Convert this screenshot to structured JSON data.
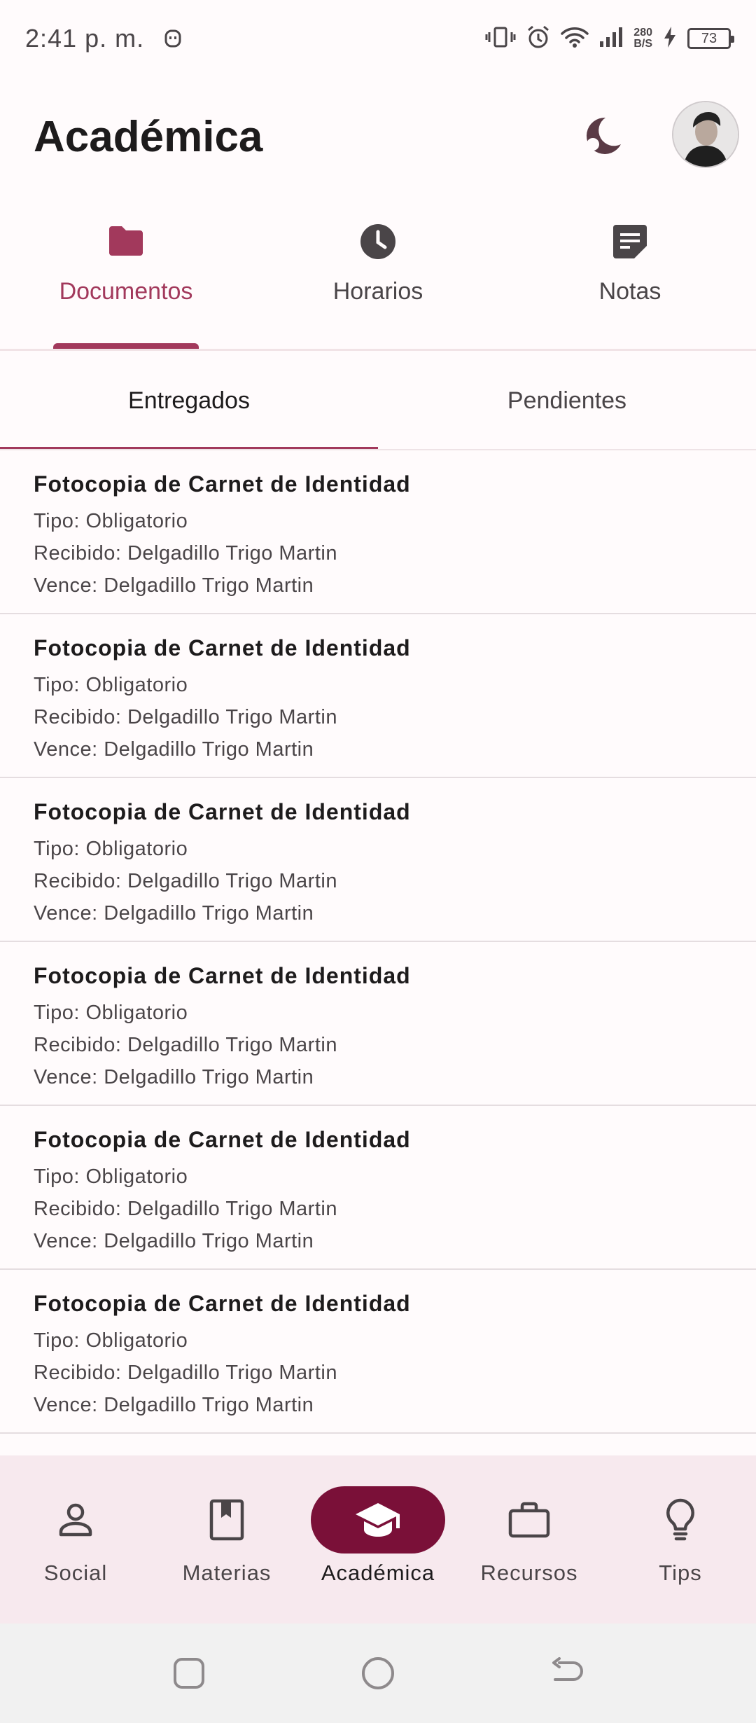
{
  "status_bar": {
    "time": "2:41 p. m.",
    "net_speed_value": "280",
    "net_speed_unit": "B/S",
    "battery": "73"
  },
  "header": {
    "title": "Académica"
  },
  "tabs": [
    {
      "label": "Documentos",
      "icon": "folder-icon",
      "active": true
    },
    {
      "label": "Horarios",
      "icon": "clock-icon",
      "active": false
    },
    {
      "label": "Notas",
      "icon": "note-icon",
      "active": false
    }
  ],
  "subtabs": [
    {
      "label": "Entregados",
      "active": true
    },
    {
      "label": "Pendientes",
      "active": false
    }
  ],
  "documents": [
    {
      "title": "Fotocopia de Carnet de Identidad",
      "tipo": "Tipo: Obligatorio",
      "recibido": "Recibido: Delgadillo Trigo Martin",
      "vence": "Vence: Delgadillo Trigo Martin"
    },
    {
      "title": "Fotocopia de Carnet de Identidad",
      "tipo": "Tipo: Obligatorio",
      "recibido": "Recibido: Delgadillo Trigo Martin",
      "vence": "Vence: Delgadillo Trigo Martin"
    },
    {
      "title": "Fotocopia de Carnet de Identidad",
      "tipo": "Tipo: Obligatorio",
      "recibido": "Recibido: Delgadillo Trigo Martin",
      "vence": "Vence: Delgadillo Trigo Martin"
    },
    {
      "title": "Fotocopia de Carnet de Identidad",
      "tipo": "Tipo: Obligatorio",
      "recibido": "Recibido: Delgadillo Trigo Martin",
      "vence": "Vence: Delgadillo Trigo Martin"
    },
    {
      "title": "Fotocopia de Carnet de Identidad",
      "tipo": "Tipo: Obligatorio",
      "recibido": "Recibido: Delgadillo Trigo Martin",
      "vence": "Vence: Delgadillo Trigo Martin"
    },
    {
      "title": "Fotocopia de Carnet de Identidad",
      "tipo": "Tipo: Obligatorio",
      "recibido": "Recibido: Delgadillo Trigo Martin",
      "vence": "Vence: Delgadillo Trigo Martin"
    }
  ],
  "bottom_nav": [
    {
      "label": "Social",
      "icon": "person-icon",
      "active": false
    },
    {
      "label": "Materias",
      "icon": "book-icon",
      "active": false
    },
    {
      "label": "Académica",
      "icon": "graduation-cap-icon",
      "active": true
    },
    {
      "label": "Recursos",
      "icon": "briefcase-icon",
      "active": false
    },
    {
      "label": "Tips",
      "icon": "lightbulb-icon",
      "active": false
    }
  ],
  "colors": {
    "accent": "#a2395c",
    "active_nav": "#7a1038",
    "nav_background": "#f7e9ee",
    "icon": "#4a4548"
  }
}
